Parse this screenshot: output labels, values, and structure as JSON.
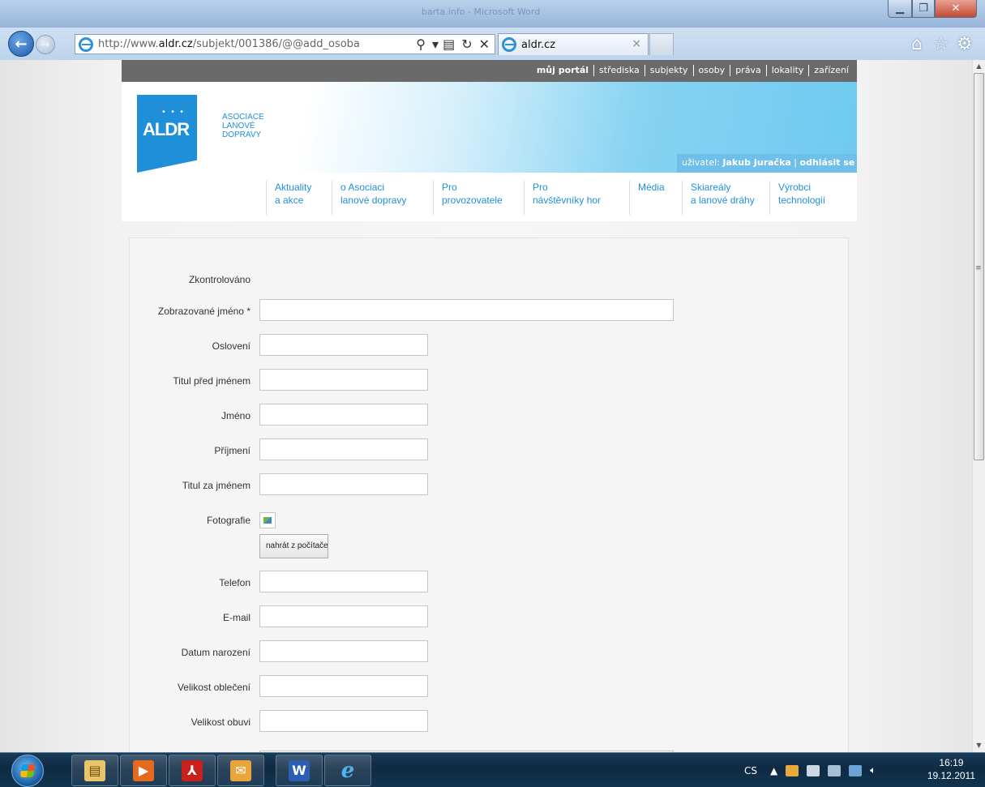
{
  "window": {
    "title": "barta.info - Microsoft Word",
    "address_url_prefix": "http://www.",
    "address_url_domain": "aldr.cz",
    "address_url_path": "/subjekt/001386/@@add_osoba",
    "tab_title": "aldr.cz"
  },
  "portal_nav": {
    "items": [
      "můj portál",
      "střediska",
      "subjekty",
      "osoby",
      "práva",
      "lokality",
      "zařízení"
    ]
  },
  "header": {
    "logo_mark": "ALDR",
    "logo_text_line1": "ASOCIACE",
    "logo_text_line2": "LANOVÉ",
    "logo_text_line3": "DOPRAVY",
    "user_label": "uživatel:",
    "user_name": "Jakub Juračka",
    "logout_label": "odhlásit se"
  },
  "main_menu": [
    {
      "line1": "Aktuality",
      "line2": "a akce"
    },
    {
      "line1": "o Asociaci",
      "line2": "lanové dopravy"
    },
    {
      "line1": "Pro",
      "line2": "provozovatele"
    },
    {
      "line1": "Pro",
      "line2": "návštěvníky hor"
    },
    {
      "line1": "Média",
      "line2": ""
    },
    {
      "line1": "Skiareály",
      "line2": "a lanové dráhy"
    },
    {
      "line1": "Výrobci",
      "line2": "technologií"
    }
  ],
  "form": {
    "checked_label": "Zkontrolováno",
    "display_name_label": "Zobrazované jméno *",
    "salutation_label": "Oslovení",
    "title_before_label": "Titul před jménem",
    "first_name_label": "Jméno",
    "last_name_label": "Příjmení",
    "title_after_label": "Titul za jménem",
    "photo_label": "Fotografie",
    "upload_button": "nahrát z počítače",
    "phone_label": "Telefon",
    "email_label": "E-mail",
    "birth_date_label": "Datum narození",
    "clothing_size_label": "Velikost oblečení",
    "shoe_size_label": "Velikost obuvi"
  },
  "taskbar": {
    "language": "CS",
    "time": "16:19",
    "date": "19.12.2011"
  },
  "colors": {
    "brand_blue": "#1f8fd9",
    "nav_gray": "#6a6a6a",
    "user_bar": "#6ec0ea"
  },
  "icons": [
    "back-arrow-icon",
    "forward-arrow-icon",
    "ie-icon",
    "search-icon",
    "compatibility-icon",
    "refresh-icon",
    "stop-icon",
    "home-icon",
    "favorites-star-icon",
    "tools-gear-icon",
    "windows-start-icon",
    "explorer-icon",
    "media-player-icon",
    "pdf-icon",
    "outlook-icon",
    "word-icon",
    "internet-explorer-icon"
  ]
}
